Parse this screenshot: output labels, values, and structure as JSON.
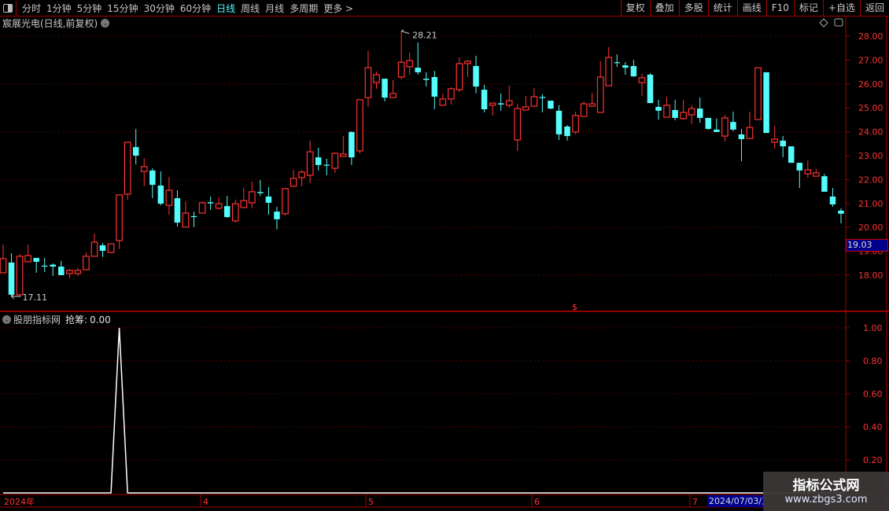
{
  "toolbar": {
    "periods": [
      "分时",
      "1分钟",
      "5分钟",
      "15分钟",
      "30分钟",
      "60分钟",
      "日线",
      "周线",
      "月线",
      "多周期",
      "更多 >"
    ],
    "active_period": "日线",
    "buttons": [
      "复权",
      "叠加",
      "多股",
      "统计",
      "画线",
      "F10",
      "标记",
      "+自选",
      "返回"
    ]
  },
  "main_chart": {
    "title": "宸展光电(日线,前复权)",
    "high_label": "28.21",
    "low_label": "17.11",
    "price_ticks": [
      "28.00",
      "27.00",
      "26.00",
      "25.00",
      "24.00",
      "23.00",
      "22.00",
      "21.00",
      "20.00",
      "19.00",
      "18.00"
    ],
    "current_price": "19.03",
    "marker": "$",
    "colors": {
      "up": "#ff3232",
      "down": "#54fcfc",
      "grid": "#a00000"
    }
  },
  "indicator": {
    "name": "股朋指标网",
    "series_label": "抢筹:",
    "value": "0.00",
    "ticks": [
      "1.00",
      "0.80",
      "0.60",
      "0.40",
      "0.20"
    ]
  },
  "date_axis": {
    "labels": [
      "2024年",
      "4",
      "5",
      "6",
      "7"
    ],
    "cursor_date": "2024/07/03/三"
  },
  "watermark": {
    "title": "指标公式网",
    "url": "www.zbgs3.com"
  },
  "chart_data": {
    "type": "candlestick",
    "ohlc_format": [
      "open",
      "high",
      "low",
      "close"
    ],
    "ylim": [
      17,
      28.4
    ],
    "candles": [
      [
        18.1,
        19.28,
        18.1,
        18.69
      ],
      [
        18.53,
        18.92,
        17.11,
        17.18
      ],
      [
        17.18,
        18.89,
        17.11,
        18.79
      ],
      [
        18.56,
        19.28,
        18.56,
        18.82
      ],
      [
        18.72,
        18.72,
        18.1,
        18.56
      ],
      [
        18.4,
        18.72,
        18.13,
        18.36
      ],
      [
        18.44,
        18.49,
        17.97,
        18.36
      ],
      [
        18.36,
        18.59,
        18.0,
        18.0
      ],
      [
        18.07,
        18.26,
        17.87,
        18.2
      ],
      [
        18.07,
        18.3,
        17.97,
        18.2
      ],
      [
        18.23,
        18.95,
        18.23,
        18.79
      ],
      [
        18.79,
        19.74,
        18.79,
        19.38
      ],
      [
        19.25,
        19.35,
        18.76,
        19.02
      ],
      [
        18.95,
        19.31,
        18.92,
        19.31
      ],
      [
        19.45,
        21.36,
        19.09,
        21.36
      ],
      [
        21.39,
        23.56,
        21.16,
        23.56
      ],
      [
        23.36,
        24.12,
        22.64,
        23.0
      ],
      [
        22.34,
        22.9,
        21.72,
        22.54
      ],
      [
        22.38,
        22.47,
        21.22,
        21.78
      ],
      [
        21.75,
        22.34,
        20.92,
        20.99
      ],
      [
        20.92,
        22.11,
        20.53,
        21.55
      ],
      [
        21.22,
        21.55,
        20.04,
        20.2
      ],
      [
        20.01,
        21.09,
        20.01,
        20.6
      ],
      [
        20.47,
        20.66,
        20.01,
        20.43
      ],
      [
        20.6,
        21.09,
        20.6,
        21.03
      ],
      [
        21.05,
        21.29,
        20.73,
        21.0
      ],
      [
        20.8,
        21.26,
        20.75,
        20.99
      ],
      [
        20.89,
        21.32,
        20.4,
        20.43
      ],
      [
        20.27,
        21.16,
        20.2,
        20.99
      ],
      [
        20.83,
        21.65,
        20.83,
        21.12
      ],
      [
        21.03,
        21.91,
        20.8,
        21.49
      ],
      [
        21.48,
        21.98,
        21.32,
        21.43
      ],
      [
        21.29,
        21.68,
        20.53,
        21.03
      ],
      [
        20.66,
        20.86,
        19.91,
        20.34
      ],
      [
        20.57,
        21.62,
        20.5,
        21.62
      ],
      [
        21.72,
        22.41,
        21.72,
        22.05
      ],
      [
        22.08,
        22.41,
        21.72,
        22.31
      ],
      [
        22.18,
        23.62,
        21.85,
        23.16
      ],
      [
        22.93,
        23.33,
        22.38,
        22.61
      ],
      [
        22.62,
        22.87,
        22.18,
        22.58
      ],
      [
        22.47,
        23.13,
        22.28,
        23.1
      ],
      [
        22.97,
        23.82,
        22.97,
        23.07
      ],
      [
        23.99,
        24.02,
        22.61,
        22.93
      ],
      [
        23.2,
        25.34,
        23.1,
        25.34
      ],
      [
        25.43,
        27.38,
        25.04,
        26.68
      ],
      [
        26.06,
        26.52,
        25.8,
        26.39
      ],
      [
        26.22,
        26.22,
        25.27,
        25.43
      ],
      [
        25.43,
        26.16,
        25.43,
        25.6
      ],
      [
        26.29,
        28.21,
        26.19,
        26.91
      ],
      [
        26.72,
        27.31,
        26.39,
        26.98
      ],
      [
        26.68,
        27.74,
        26.39,
        26.49
      ],
      [
        26.22,
        26.49,
        25.89,
        26.17
      ],
      [
        26.29,
        26.55,
        24.94,
        25.47
      ],
      [
        25.11,
        25.6,
        25.11,
        25.37
      ],
      [
        25.37,
        25.86,
        25.14,
        25.8
      ],
      [
        25.76,
        27.11,
        25.66,
        26.85
      ],
      [
        26.85,
        27.01,
        26.29,
        26.95
      ],
      [
        26.75,
        27.18,
        25.6,
        25.89
      ],
      [
        25.76,
        25.96,
        24.81,
        24.94
      ],
      [
        25.11,
        25.2,
        24.68,
        25.2
      ],
      [
        25.19,
        25.6,
        24.88,
        25.14
      ],
      [
        25.11,
        25.93,
        25.01,
        25.3
      ],
      [
        23.66,
        25.17,
        23.2,
        24.97
      ],
      [
        24.91,
        25.5,
        24.91,
        25.04
      ],
      [
        25.07,
        25.83,
        25.07,
        25.47
      ],
      [
        25.45,
        25.57,
        24.81,
        25.43
      ],
      [
        25.3,
        25.3,
        24.94,
        24.97
      ],
      [
        24.88,
        25.11,
        23.66,
        23.89
      ],
      [
        24.22,
        24.28,
        23.63,
        23.82
      ],
      [
        23.99,
        24.84,
        23.89,
        24.68
      ],
      [
        24.64,
        25.27,
        24.64,
        25.17
      ],
      [
        25.07,
        25.63,
        25.04,
        25.17
      ],
      [
        24.81,
        26.95,
        24.81,
        26.29
      ],
      [
        25.93,
        27.54,
        25.93,
        27.11
      ],
      [
        26.91,
        27.24,
        26.72,
        26.88
      ],
      [
        26.78,
        26.91,
        26.39,
        26.68
      ],
      [
        26.75,
        27.01,
        26.29,
        26.32
      ],
      [
        26.06,
        26.42,
        25.5,
        26.26
      ],
      [
        26.39,
        26.45,
        25.2,
        25.2
      ],
      [
        25.04,
        25.34,
        24.51,
        24.88
      ],
      [
        24.61,
        25.47,
        24.61,
        25.11
      ],
      [
        24.91,
        25.34,
        24.48,
        24.58
      ],
      [
        24.55,
        25.34,
        24.51,
        24.81
      ],
      [
        24.71,
        25.11,
        24.32,
        24.97
      ],
      [
        24.97,
        25.43,
        24.38,
        24.58
      ],
      [
        24.58,
        24.58,
        24.09,
        24.12
      ],
      [
        24.09,
        24.55,
        23.99,
        23.99
      ],
      [
        23.82,
        24.71,
        23.59,
        24.58
      ],
      [
        24.41,
        24.84,
        24.02,
        24.09
      ],
      [
        23.89,
        24.12,
        22.77,
        23.69
      ],
      [
        23.72,
        24.84,
        23.72,
        24.18
      ],
      [
        24.51,
        26.68,
        24.51,
        26.68
      ],
      [
        26.49,
        26.49,
        23.95,
        23.95
      ],
      [
        23.56,
        24.25,
        23.3,
        23.69
      ],
      [
        23.63,
        23.82,
        22.93,
        23.39
      ],
      [
        23.39,
        23.39,
        22.7,
        22.7
      ],
      [
        22.7,
        22.7,
        21.65,
        22.38
      ],
      [
        22.24,
        22.8,
        22.08,
        22.41
      ],
      [
        22.14,
        22.44,
        22.14,
        22.28
      ],
      [
        22.14,
        22.24,
        21.49,
        21.49
      ],
      [
        21.29,
        21.65,
        20.86,
        20.96
      ],
      [
        20.7,
        20.8,
        20.17,
        20.57
      ]
    ],
    "indicator_values": [
      0,
      0,
      0,
      0,
      0,
      0,
      0,
      0,
      0,
      0,
      0,
      0,
      0,
      0,
      1,
      0,
      0,
      0,
      0,
      0,
      0,
      0,
      0,
      0,
      0,
      0,
      0,
      0,
      0,
      0,
      0,
      0,
      0,
      0,
      0,
      0,
      0,
      0,
      0,
      0,
      0,
      0,
      0,
      0,
      0,
      0,
      0,
      0,
      0,
      0,
      0,
      0,
      0,
      0,
      0,
      0,
      0,
      0,
      0,
      0,
      0,
      0,
      0,
      0,
      0,
      0,
      0,
      0,
      0,
      0,
      0,
      0,
      0,
      0,
      0,
      0,
      0,
      0,
      0,
      0,
      0,
      0,
      0,
      0,
      0,
      0,
      0,
      0,
      0,
      0,
      0,
      0,
      0,
      0,
      0,
      0,
      0,
      0,
      0,
      0,
      0,
      0
    ],
    "indicator_ylim": [
      0,
      1.0
    ]
  }
}
